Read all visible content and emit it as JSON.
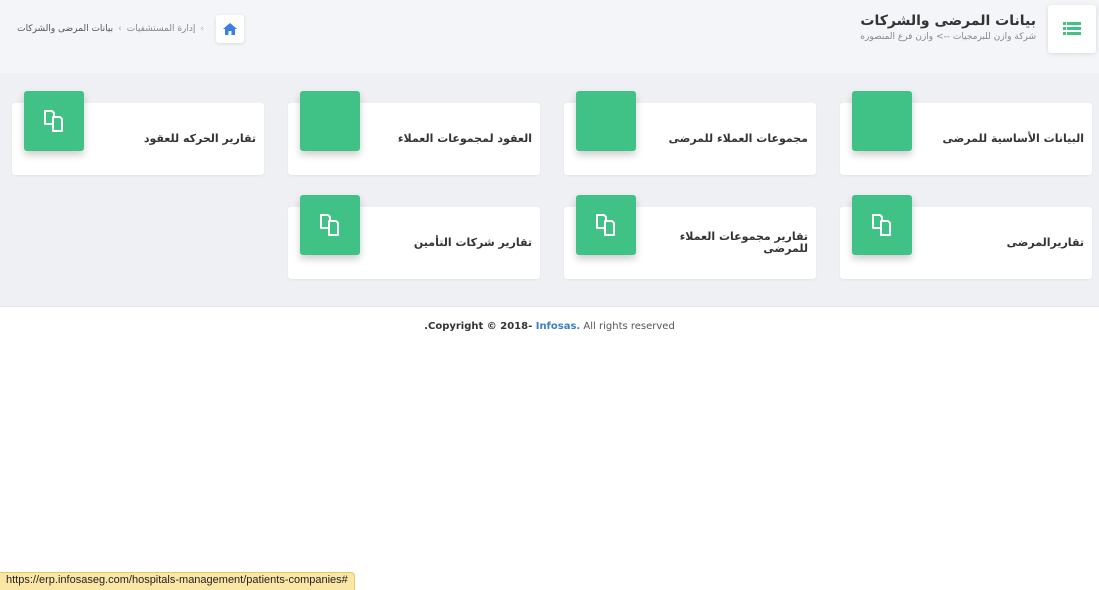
{
  "header": {
    "title": "بيانات المرضى والشركات",
    "subtitle": "شركة وازن للبرمجيات --> وازن فرع المنصوره",
    "menu_icon": "list-icon"
  },
  "breadcrumb": {
    "home_icon": "home-icon",
    "items": [
      "إدارة المستشفيات",
      "بيانات المرضى والشركات"
    ]
  },
  "cards": [
    {
      "label": "البيانات الأساسية للمرضى",
      "icon": ""
    },
    {
      "label": "مجموعات العملاء للمرضى",
      "icon": ""
    },
    {
      "label": "العقود لمجموعات العملاء",
      "icon": ""
    },
    {
      "label": "تقارير الحركه للعقود",
      "icon": "copy-icon"
    },
    {
      "label": "تقاريرالمرضى",
      "icon": "copy-icon"
    },
    {
      "label": "تقارير مجموعات العملاء للمرضى",
      "icon": "copy-icon"
    },
    {
      "label": "تقارير شركات التأمين",
      "icon": "copy-icon"
    }
  ],
  "footer": {
    "prefix": "Copyright © 2018- ",
    "brand": "Infosas.",
    "suffix": " All rights reserved",
    "dot": "."
  },
  "status_url": "https://erp.infosaseg.com/hospitals-management/patients-companies#",
  "colors": {
    "accent": "#40c185",
    "link": "#3b7fc4"
  }
}
